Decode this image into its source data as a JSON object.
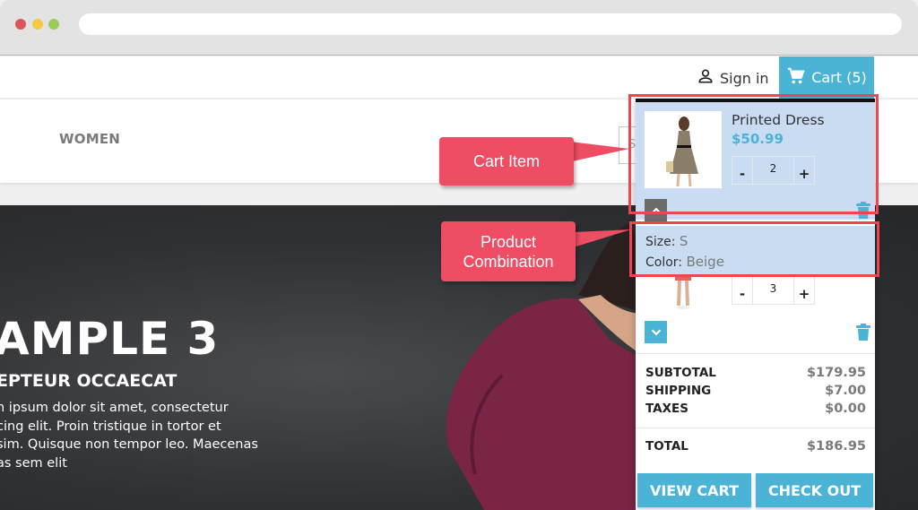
{
  "browser": {
    "url": ""
  },
  "topbar": {
    "sign_in_label": "Sign in",
    "cart_label": "Cart (5)"
  },
  "nav": {
    "items": [
      {
        "label": "WOMEN"
      }
    ],
    "search_placeholder": "S"
  },
  "hero": {
    "title": "AMPLE 3",
    "subtitle": "EPTEUR OCCAECAT",
    "text_lines": [
      "n ipsum dolor sit amet, consectetur",
      "cing elit. Proin tristique in tortor et",
      "sim. Quisque non tempor leo. Maecenas",
      "as sem elit"
    ]
  },
  "cart": {
    "items": [
      {
        "name": "Printed Dress",
        "price": "$50.99",
        "quantity": "2",
        "attributes": [
          {
            "label": "Size:",
            "value": "S"
          },
          {
            "label": "Color:",
            "value": "Beige"
          }
        ]
      },
      {
        "quantity": "3"
      }
    ],
    "qty_minus": "-",
    "qty_plus": "+",
    "totals": [
      {
        "label": "SUBTOTAL",
        "amount": "$179.95"
      },
      {
        "label": "SHIPPING",
        "amount": "$7.00"
      },
      {
        "label": "TAXES",
        "amount": "$0.00"
      }
    ],
    "grand_total": {
      "label": "TOTAL",
      "amount": "$186.95"
    },
    "view_cart_label": "VIEW CART",
    "checkout_label": "CHECK OUT"
  },
  "annotations": {
    "cart_item": "Cart Item",
    "product_combination_line1": "Product",
    "product_combination_line2": "Combination"
  },
  "colors": {
    "accent": "#4bb3d6",
    "highlight": "#c9dcf2",
    "annotation": "#ef4d63",
    "annotation_border": "#ef4550"
  }
}
